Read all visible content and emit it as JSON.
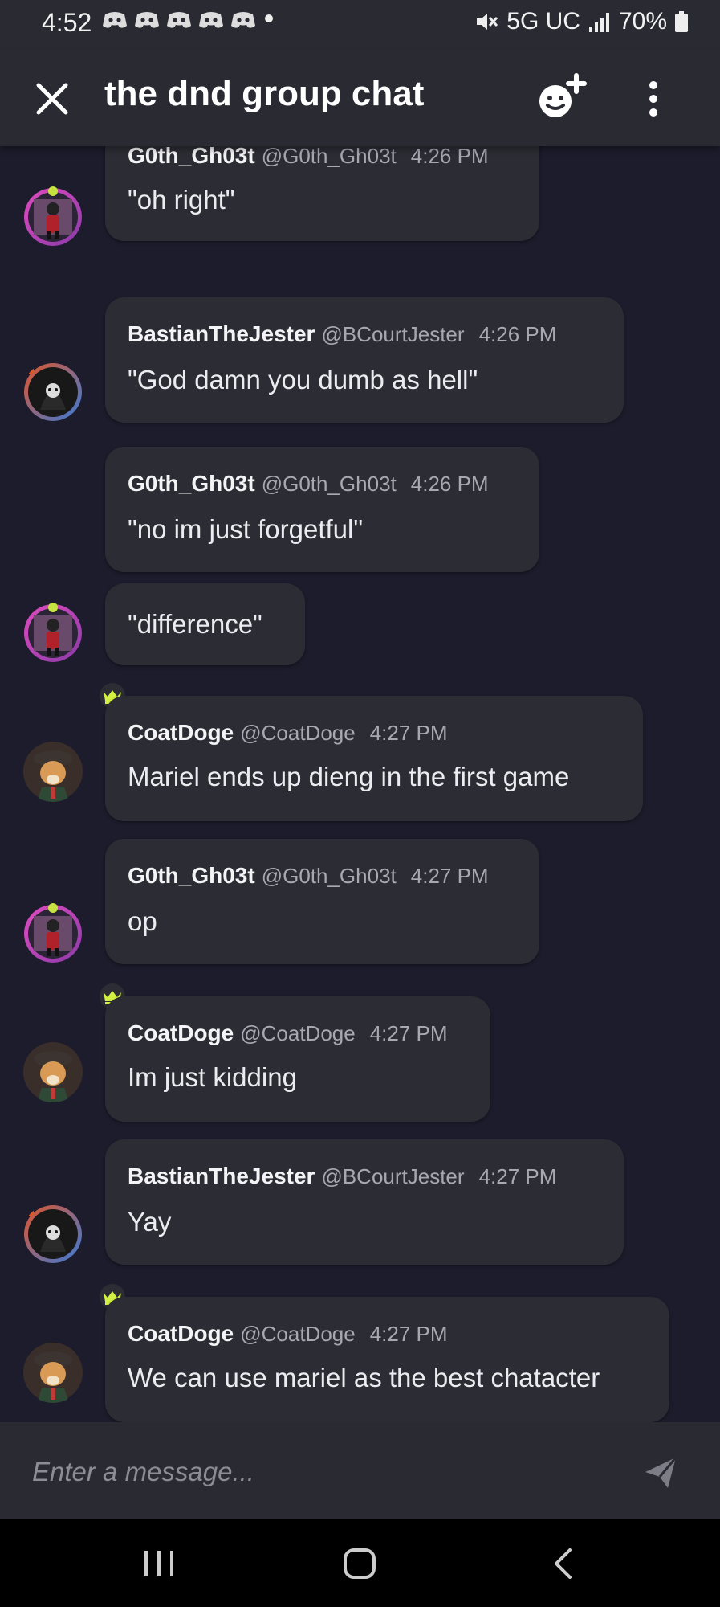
{
  "status_bar": {
    "time": "4:52",
    "network": "5G UC",
    "battery": "70%"
  },
  "header": {
    "title": "the dnd group chat"
  },
  "composer": {
    "placeholder": "Enter a message..."
  },
  "messages": [
    {
      "username": "G0th_Gh03t",
      "handle": "@G0th_Gh03t",
      "time": "4:26 PM",
      "text": "\"oh right\"",
      "avatar": "goth-avatar"
    },
    {
      "username": "BastianTheJester",
      "handle": "@BCourtJester",
      "time": "4:26 PM",
      "text": "\"God damn you dumb as hell\"",
      "avatar": "jester-avatar"
    },
    {
      "username": "G0th_Gh03t",
      "handle": "@G0th_Gh03t",
      "time": "4:26 PM",
      "text": "\"no im just forgetful\"",
      "avatar": "goth-avatar"
    },
    {
      "text": "\"difference\"",
      "continuation": true
    },
    {
      "username": "CoatDoge",
      "handle": "@CoatDoge",
      "time": "4:27 PM",
      "text": "Mariel ends up dieng in the first game",
      "avatar": "doge-avatar",
      "crown": true
    },
    {
      "username": "G0th_Gh03t",
      "handle": "@G0th_Gh03t",
      "time": "4:27 PM",
      "text": "op",
      "avatar": "goth-avatar"
    },
    {
      "username": "CoatDoge",
      "handle": "@CoatDoge",
      "time": "4:27 PM",
      "text": "Im just kidding",
      "avatar": "doge-avatar",
      "crown": true
    },
    {
      "username": "BastianTheJester",
      "handle": "@BCourtJester",
      "time": "4:27 PM",
      "text": "Yay",
      "avatar": "jester-avatar"
    },
    {
      "username": "CoatDoge",
      "handle": "@CoatDoge",
      "time": "4:27 PM",
      "text": "We can use mariel as the best chatacter",
      "avatar": "doge-avatar",
      "crown": true
    }
  ],
  "colors": {
    "background": "#1c1c2c",
    "bubble": "#2c2c34",
    "header": "#2a2a32",
    "crown": "#d4f040"
  }
}
